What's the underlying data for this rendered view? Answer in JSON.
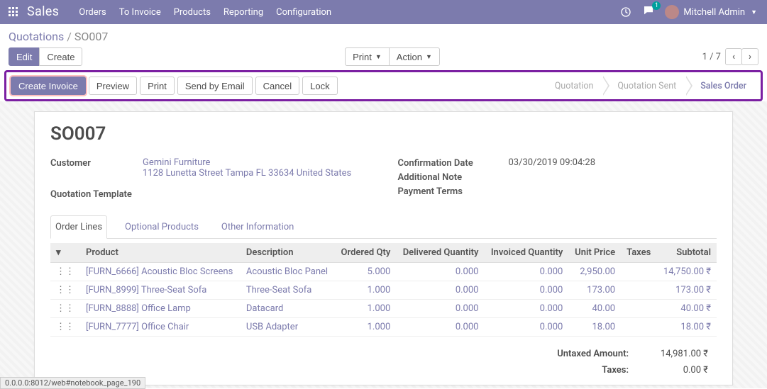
{
  "brand": "Sales",
  "topmenu": [
    "Orders",
    "To Invoice",
    "Products",
    "Reporting",
    "Configuration"
  ],
  "user": "Mitchell Admin",
  "chat_count": "1",
  "breadcrumb": {
    "root": "Quotations",
    "current": "SO007"
  },
  "buttons": {
    "edit": "Edit",
    "create": "Create",
    "print": "Print",
    "action": "Action"
  },
  "pager": "1 / 7",
  "statusbar_buttons": {
    "create_invoice": "Create Invoice",
    "preview": "Preview",
    "print": "Print",
    "send_email": "Send by Email",
    "cancel": "Cancel",
    "lock": "Lock"
  },
  "stages": [
    "Quotation",
    "Quotation Sent",
    "Sales Order"
  ],
  "record": {
    "name": "SO007",
    "labels": {
      "customer": "Customer",
      "quot_tpl": "Quotation Template",
      "conf_date": "Confirmation Date",
      "add_note": "Additional Note",
      "pay_terms": "Payment Terms"
    },
    "customer_name": "Gemini Furniture",
    "addr1": "1128 Lunetta Street",
    "addr2": "Tampa FL 33634",
    "addr3": "United States",
    "conf_date": "03/30/2019 09:04:28"
  },
  "tabs": [
    "Order Lines",
    "Optional Products",
    "Other Information"
  ],
  "columns": {
    "product": "Product",
    "desc": "Description",
    "oqty": "Ordered Qty",
    "dqty": "Delivered Quantity",
    "iqty": "Invoiced Quantity",
    "price": "Unit Price",
    "taxes": "Taxes",
    "subtotal": "Subtotal"
  },
  "lines": [
    {
      "product": "[FURN_6666] Acoustic Bloc Screens",
      "desc": "Acoustic Bloc Panel",
      "oqty": "5.000",
      "dqty": "0.000",
      "iqty": "0.000",
      "price": "2,950.00",
      "subtotal": "14,750.00 ₹"
    },
    {
      "product": "[FURN_8999] Three-Seat Sofa",
      "desc": "Three-Seat Sofa",
      "oqty": "1.000",
      "dqty": "0.000",
      "iqty": "0.000",
      "price": "173.00",
      "subtotal": "173.00 ₹"
    },
    {
      "product": "[FURN_8888] Office Lamp",
      "desc": "Datacard",
      "oqty": "1.000",
      "dqty": "0.000",
      "iqty": "0.000",
      "price": "40.00",
      "subtotal": "40.00 ₹"
    },
    {
      "product": "[FURN_7777] Office Chair",
      "desc": "USB Adapter",
      "oqty": "1.000",
      "dqty": "0.000",
      "iqty": "0.000",
      "price": "18.00",
      "subtotal": "18.00 ₹"
    }
  ],
  "totals": {
    "untaxed_lbl": "Untaxed Amount:",
    "untaxed": "14,981.00 ₹",
    "taxes_lbl": "Taxes:",
    "taxes": "0.00 ₹"
  },
  "status_url": "0.0.0.0:8012/web#notebook_page_190"
}
